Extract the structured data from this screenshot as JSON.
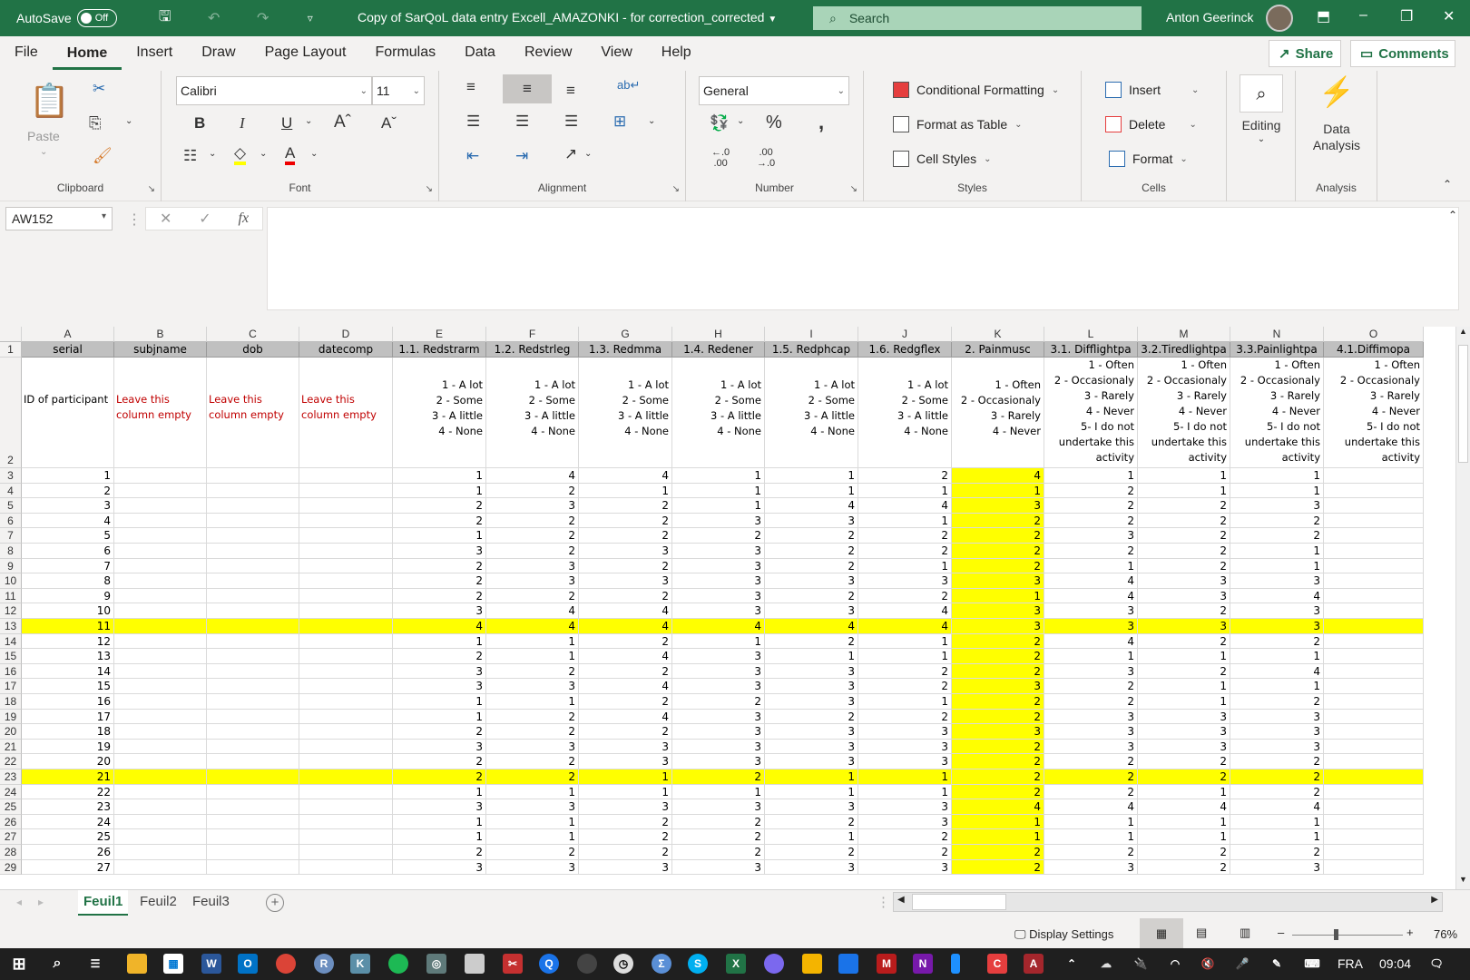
{
  "titlebar": {
    "autosave_label": "AutoSave",
    "autosave_state": "Off",
    "document_title": "Copy of SarQoL data entry Excell_AMAZONKI - for correction_corrected",
    "search_placeholder": "Search",
    "user_name": "Anton Geerinck",
    "accent_color": "#217346"
  },
  "menu": {
    "tabs": [
      "File",
      "Home",
      "Insert",
      "Draw",
      "Page Layout",
      "Formulas",
      "Data",
      "Review",
      "View",
      "Help"
    ],
    "active_tab": "Home",
    "share_label": "Share",
    "comments_label": "Comments"
  },
  "ribbon": {
    "clipboard": {
      "label": "Clipboard",
      "paste_label": "Paste"
    },
    "font": {
      "label": "Font",
      "font_name": "Calibri",
      "font_size": "11",
      "bold": "B",
      "italic": "I",
      "underline": "U"
    },
    "alignment": {
      "label": "Alignment"
    },
    "number": {
      "label": "Number",
      "format": "General"
    },
    "styles": {
      "label": "Styles",
      "conditional_formatting": "Conditional Formatting",
      "format_as_table": "Format as Table",
      "cell_styles": "Cell Styles"
    },
    "cells": {
      "label": "Cells",
      "insert": "Insert",
      "delete": "Delete",
      "format": "Format"
    },
    "editing": {
      "label": "Editing"
    },
    "analysis": {
      "label": "Analysis",
      "data_analysis_line1": "Data",
      "data_analysis_line2": "Analysis"
    }
  },
  "formula_bar": {
    "name_box": "AW152",
    "fx": "fx",
    "formula": ""
  },
  "sheet": {
    "columns": [
      "A",
      "B",
      "C",
      "D",
      "E",
      "F",
      "G",
      "H",
      "I",
      "J",
      "K",
      "L",
      "M",
      "N",
      "O"
    ],
    "headers": [
      "serial",
      "subjname",
      "dob",
      "datecomp",
      "1.1. Redstrarm",
      "1.2. Redstrleg",
      "1.3. Redmma",
      "1.4. Redener",
      "1.5. Redphcap",
      "1.6. Redgflex",
      "2. Painmusc",
      "3.1. Difflightpa",
      "3.2.Tiredlightpa",
      "3.3.Painlightpa",
      "4.1.Diffimopa"
    ],
    "descriptions": {
      "A": "ID of participant",
      "B": "Leave this column empty",
      "C": "Leave this column empty",
      "D": "Leave this column empty",
      "scale_alot": [
        "1 - A lot",
        "2 - Some",
        "3 - A little",
        "4 - None"
      ],
      "scale_often4": [
        "1 - Often",
        "2 - Occasionaly",
        "3 - Rarely",
        "4 - Never"
      ],
      "scale_often5": [
        "1 - Often",
        "2 - Occasionaly",
        "3 - Rarely",
        "4 - Never",
        "5- I do not",
        "undertake this",
        "activity"
      ]
    },
    "highlight_color": "#ffff00",
    "highlighted_rows": [
      13,
      23
    ],
    "highlighted_column": "K",
    "rows": [
      {
        "row": 3,
        "serial": 1,
        "values": [
          1,
          4,
          4,
          1,
          1,
          2,
          4,
          1,
          1,
          1
        ]
      },
      {
        "row": 4,
        "serial": 2,
        "values": [
          1,
          2,
          1,
          1,
          1,
          1,
          1,
          2,
          1,
          1
        ]
      },
      {
        "row": 5,
        "serial": 3,
        "values": [
          2,
          3,
          2,
          1,
          4,
          4,
          3,
          2,
          2,
          3
        ]
      },
      {
        "row": 6,
        "serial": 4,
        "values": [
          2,
          2,
          2,
          3,
          3,
          1,
          2,
          2,
          2,
          2
        ]
      },
      {
        "row": 7,
        "serial": 5,
        "values": [
          1,
          2,
          2,
          2,
          2,
          2,
          2,
          3,
          2,
          2
        ]
      },
      {
        "row": 8,
        "serial": 6,
        "values": [
          3,
          2,
          3,
          3,
          2,
          2,
          2,
          2,
          2,
          1
        ]
      },
      {
        "row": 9,
        "serial": 7,
        "values": [
          2,
          3,
          2,
          3,
          2,
          1,
          2,
          1,
          2,
          1
        ]
      },
      {
        "row": 10,
        "serial": 8,
        "values": [
          2,
          3,
          3,
          3,
          3,
          3,
          3,
          4,
          3,
          3
        ]
      },
      {
        "row": 11,
        "serial": 9,
        "values": [
          2,
          2,
          2,
          3,
          2,
          2,
          1,
          4,
          3,
          4
        ]
      },
      {
        "row": 12,
        "serial": 10,
        "values": [
          3,
          4,
          4,
          3,
          3,
          4,
          3,
          3,
          2,
          3
        ]
      },
      {
        "row": 13,
        "serial": 11,
        "values": [
          4,
          4,
          4,
          4,
          4,
          4,
          3,
          3,
          3,
          3
        ]
      },
      {
        "row": 14,
        "serial": 12,
        "values": [
          1,
          1,
          2,
          1,
          2,
          1,
          2,
          4,
          2,
          2
        ]
      },
      {
        "row": 15,
        "serial": 13,
        "values": [
          2,
          1,
          4,
          3,
          1,
          1,
          2,
          1,
          1,
          1
        ]
      },
      {
        "row": 16,
        "serial": 14,
        "values": [
          3,
          2,
          2,
          3,
          3,
          2,
          2,
          3,
          2,
          4
        ]
      },
      {
        "row": 17,
        "serial": 15,
        "values": [
          3,
          3,
          4,
          3,
          3,
          2,
          3,
          2,
          1,
          1
        ]
      },
      {
        "row": 18,
        "serial": 16,
        "values": [
          1,
          1,
          2,
          2,
          3,
          1,
          2,
          2,
          1,
          2
        ]
      },
      {
        "row": 19,
        "serial": 17,
        "values": [
          1,
          2,
          4,
          3,
          2,
          2,
          2,
          3,
          3,
          3
        ]
      },
      {
        "row": 20,
        "serial": 18,
        "values": [
          2,
          2,
          2,
          3,
          3,
          3,
          3,
          3,
          3,
          3
        ]
      },
      {
        "row": 21,
        "serial": 19,
        "values": [
          3,
          3,
          3,
          3,
          3,
          3,
          2,
          3,
          3,
          3
        ]
      },
      {
        "row": 22,
        "serial": 20,
        "values": [
          2,
          2,
          3,
          3,
          3,
          3,
          2,
          2,
          2,
          2
        ]
      },
      {
        "row": 23,
        "serial": 21,
        "values": [
          2,
          2,
          1,
          2,
          1,
          1,
          2,
          2,
          2,
          2
        ]
      },
      {
        "row": 24,
        "serial": 22,
        "values": [
          1,
          1,
          1,
          1,
          1,
          1,
          2,
          2,
          1,
          2
        ]
      },
      {
        "row": 25,
        "serial": 23,
        "values": [
          3,
          3,
          3,
          3,
          3,
          3,
          4,
          4,
          4,
          4
        ]
      },
      {
        "row": 26,
        "serial": 24,
        "values": [
          1,
          1,
          2,
          2,
          2,
          3,
          1,
          1,
          1,
          1
        ]
      },
      {
        "row": 27,
        "serial": 25,
        "values": [
          1,
          1,
          2,
          2,
          1,
          2,
          1,
          1,
          1,
          1
        ]
      },
      {
        "row": 28,
        "serial": 26,
        "values": [
          2,
          2,
          2,
          2,
          2,
          2,
          2,
          2,
          2,
          2
        ]
      },
      {
        "row": 29,
        "serial": 27,
        "values": [
          3,
          3,
          3,
          3,
          3,
          3,
          2,
          3,
          2,
          3
        ]
      }
    ]
  },
  "sheet_tabs": {
    "tabs": [
      "Feuil1",
      "Feuil2",
      "Feuil3"
    ],
    "active": "Feuil1"
  },
  "status": {
    "display_settings": "Display Settings",
    "zoom": "76%",
    "zoom_fraction": 0.38
  },
  "taskbar": {
    "language": "FRA",
    "time": "09:04"
  }
}
